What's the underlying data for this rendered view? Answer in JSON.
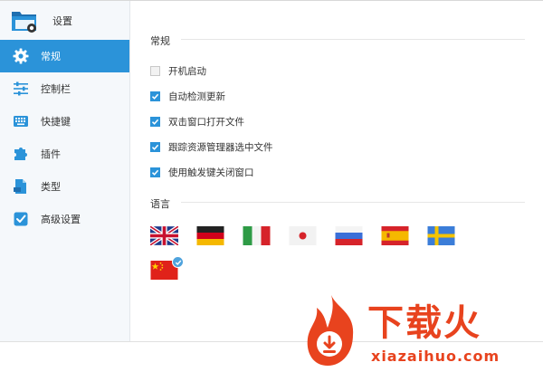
{
  "app": {
    "title": "设置"
  },
  "sidebar": {
    "items": [
      {
        "label": "常规",
        "icon": "gear-icon",
        "active": true
      },
      {
        "label": "控制栏",
        "icon": "sliders-icon"
      },
      {
        "label": "快捷键",
        "icon": "keyboard-icon"
      },
      {
        "label": "插件",
        "icon": "puzzle-icon"
      },
      {
        "label": "类型",
        "icon": "file-type-icon"
      },
      {
        "label": "高级设置",
        "icon": "advanced-check-icon"
      }
    ]
  },
  "general": {
    "title": "常规",
    "options": [
      {
        "label": "开机启动",
        "checked": false
      },
      {
        "label": "自动检测更新",
        "checked": true
      },
      {
        "label": "双击窗口打开文件",
        "checked": true
      },
      {
        "label": "跟踪资源管理器选中文件",
        "checked": true
      },
      {
        "label": "使用触发键关闭窗口",
        "checked": true
      }
    ]
  },
  "language": {
    "title": "语言",
    "flags": [
      {
        "name": "uk-flag",
        "selected": false
      },
      {
        "name": "germany-flag",
        "selected": false
      },
      {
        "name": "italy-flag",
        "selected": false
      },
      {
        "name": "japan-flag",
        "selected": false
      },
      {
        "name": "russia-flag",
        "selected": false
      },
      {
        "name": "spain-flag",
        "selected": false
      },
      {
        "name": "sweden-flag",
        "selected": false
      },
      {
        "name": "china-flag",
        "selected": true
      }
    ]
  },
  "watermark": {
    "text": "下载火",
    "url": "xiazaihuo.com"
  },
  "colors": {
    "accent": "#2b93d9",
    "watermark": "#e8431e"
  }
}
